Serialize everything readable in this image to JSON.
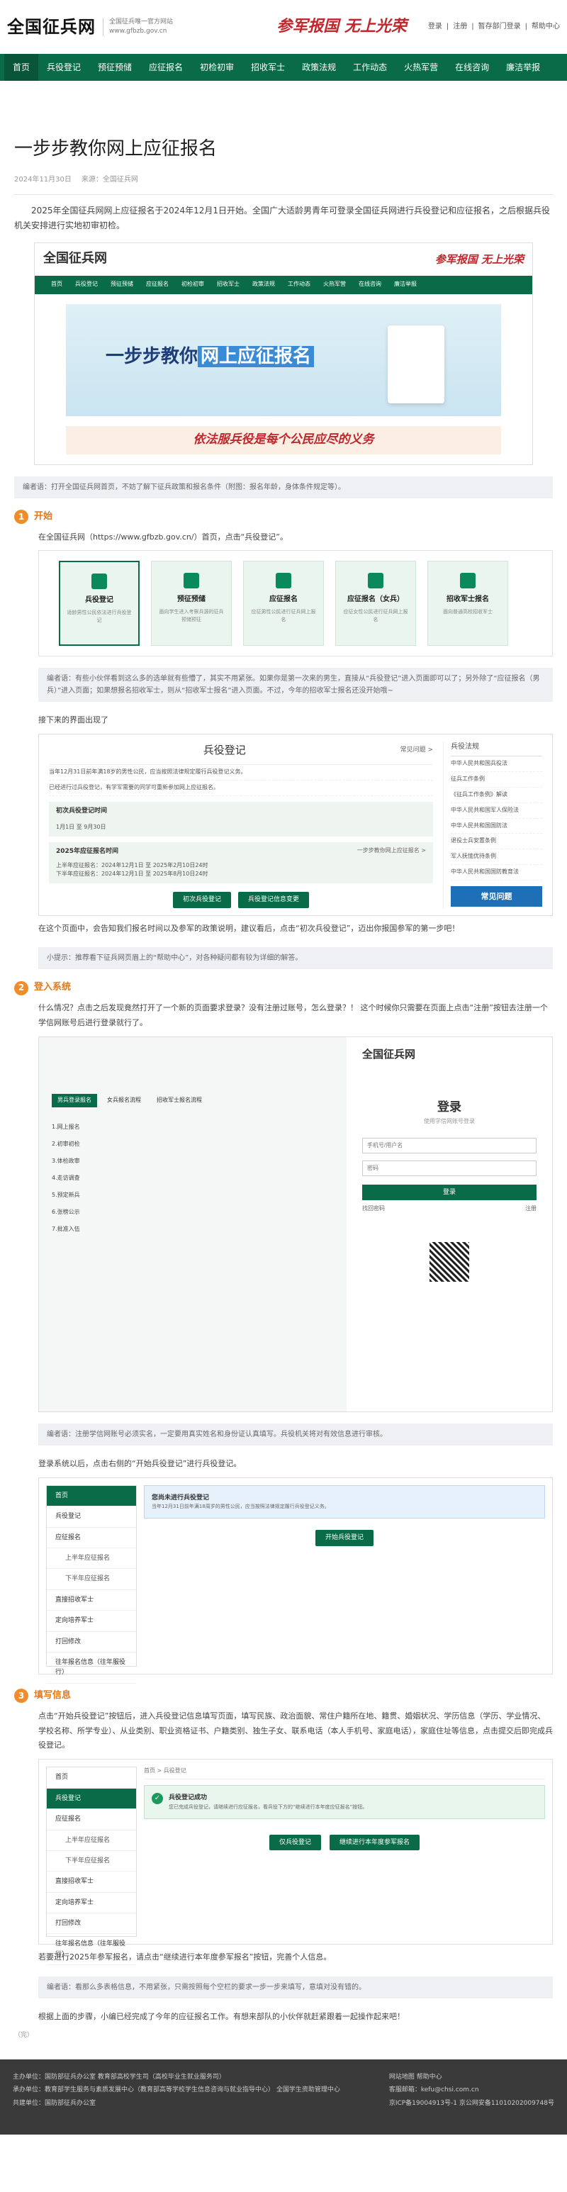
{
  "site": {
    "logo": "全国征兵网",
    "logo_sub1": "全国征兵唯一官方网站",
    "logo_sub2": "www.gfbzb.gov.cn",
    "slogan": "参军报国 无上光荣",
    "toplinks": [
      "登录",
      "注册",
      "暂存部门登录",
      "帮助中心"
    ]
  },
  "nav": [
    "首页",
    "兵役登记",
    "预征预储",
    "应征报名",
    "初检初审",
    "招收军士",
    "政策法规",
    "工作动态",
    "火热军营",
    "在线咨询",
    "廉洁举报"
  ],
  "article": {
    "title": "一步步教你网上应征报名",
    "date": "2024年11月30日",
    "source": "来源：全国征兵网",
    "intro": "2025年全国征兵网网上应征报名于2024年12月1日开始。全国广大适龄男青年可登录全国征兵网进行兵役登记和应征报名，之后根据兵役机关安排进行实地初审初检。",
    "banner_text_a": "一步步教你",
    "banner_text_b": "网上应征报名",
    "banner2_text": "依法服兵役是每个公民应尽的义务",
    "note1": "编者语：打开全国征兵网首页，不妨了解下征兵政策和报名条件（附图：报名年龄，身体条件规定等）。"
  },
  "step1": {
    "num": "1",
    "title": "开始",
    "text": "在全国征兵网（https://www.gfbzb.gov.cn/）首页，点击“兵役登记”。",
    "cards": [
      {
        "title": "兵役登记",
        "desc": "适龄男性公民依法进行兵役登记"
      },
      {
        "title": "预征预储",
        "desc": "面向学生进入考察兵源的征兵预储预征"
      },
      {
        "title": "应征报名",
        "desc": "应征男性公民进行征兵网上报名"
      },
      {
        "title": "应征报名（女兵）",
        "desc": "应征女性公民进行征兵网上报名"
      },
      {
        "title": "招收军士报名",
        "desc": "面向普通高校招收军士"
      }
    ],
    "note": "编者语：有些小伙伴看到这么多的选单就有些懵了，其实不用紧张。如果你是第一次来的男生，直接从“兵役登记”进入页面即可以了；另外除了“应征报名（男兵）”进入页面；如果想报名招收军士，则从“招收军士报名”进入页面。不过，今年的招收军士报名还没开始哦~",
    "text2": "接下来的界面出现了",
    "panel_title": "兵役登记",
    "panel_link": "常见问题 >",
    "panel_lines": [
      "当年12月31日前年满18岁的男性公民，应当按照法律规定履行兵役登记义务。",
      "已经进行过兵役登记，有学军需要的同学可重新参加网上应征报名。"
    ],
    "box1_title": "初次兵役登记时间",
    "box1_value": "1月1日 至 9月30日",
    "box2_title": "2025年应征报名时间",
    "box2_link": "一步步教你网上应征报名 >",
    "box2_lines": [
      "上半年应征报名：2024年12月1日 至 2025年2月10日24时",
      "下半年应征报名：2024年12月1日 至 2025年8月10日24时"
    ],
    "btn1": "初次兵役登记",
    "btn2": "兵役登记信息变更",
    "side_title": "兵役法规",
    "side_items": [
      "中华人民共和国兵役法",
      "征兵工作条例",
      "《征兵工作条例》解读",
      "中华人民共和国军人保险法",
      "中华人民共和国国防法",
      "退役士兵安置条例",
      "军人抚恤优待条例",
      "中华人民共和国国防教育法"
    ],
    "side_btn": "常见问题",
    "text3": "在这个页面中，会告知我们报名时间以及参军的政策说明，建议看后，点击“初次兵役登记”，迈出你报国参军的第一步吧！",
    "note2": "小提示：推荐看下征兵网页眉上的“帮助中心”，对各种疑问都有较为详细的解答。"
  },
  "step2": {
    "num": "2",
    "title": "登入系统",
    "text": "什么情况？点击之后发现竟然打开了一个新的页面要求登录？没有注册过账号，怎么登录？！ 这个时候你只需要在页面上点击“注册”按钮去注册一个学信网账号后进行登录就行了。",
    "login_title": "登录",
    "login_sub": "使用学信网账号登录",
    "ph_phone": "手机号/用户名",
    "ph_pwd": "密码",
    "login_btn": "登录",
    "forgot": "找回密码",
    "register": "注册",
    "tabs": [
      "男兵登录报名",
      "女兵报名流程",
      "招收军士报名流程"
    ],
    "flow": [
      "1.网上报名",
      "2.初审初检",
      "3.体检政审",
      "4.走访调查",
      "5.预定新兵",
      "6.张榜公示",
      "7.批准入伍"
    ],
    "note": "编者语：注册学信网账号必须实名，一定要用真实姓名和身份证认真填写。兵役机关将对有效信息进行审核。",
    "text2": "登录系统以后，点击右侧的“开始兵役登记”进行兵役登记。",
    "menu": [
      "首页",
      "兵役登记",
      "应征报名",
      "上半年应征报名",
      "下半年应征报名",
      "直接招收军士",
      "定向培养军士",
      "打回修改",
      "往年报名信息（往年服役行）"
    ],
    "notice": "您尚未进行兵役登记",
    "notice_sub": "当年12月31日前年满18周岁的男性公民，应当按照法律规定履行兵役登记义务。",
    "start_btn": "开始兵役登记"
  },
  "step3": {
    "num": "3",
    "title": "填写信息",
    "text": "点击“开始兵役登记”按钮后，进入兵役登记信息填写页面，填写民族、政治面貌、常住户籍所在地、籍贯、婚姻状况、学历信息（学历、学业情况、学校名称、所学专业）、从业类别、职业资格证书、户籍类别、独生子女、联系电话（本人手机号、家庭电话），家庭住址等信息，点击提交后即完成兵役登记。",
    "crumb": "首页 > 兵役登记",
    "done": "兵役登记成功",
    "done_sub": "您已完成兵役登记，请继续进行应征报名，看兵役下方的“继续进行本年度应征报名”按钮。",
    "btn1": "仅兵役登记",
    "btn2": "继续进行本年度参军报名",
    "text2": "若要进行2025年参军报名，请点击“继续进行本年度参军报名”按钮，完善个人信息。",
    "note": "编者语：看那么多表格信息，不用紧张，只需按照每个空栏的要求一步一步来填写，意填对没有错的。",
    "text3": "根据上面的步骤，小编已经完成了今年的应征报名工作。有想来部队的小伙伴就赶紧跟着一起操作起来吧！",
    "editor": "（完）"
  },
  "footer": {
    "left": [
      "主办单位：国防部征兵办公室  教育部高校学生司（高校毕业生就业服务司）",
      "承办单位：教育部学生服务与素质发展中心（教育部高等学校学生信息咨询与就业指导中心）  全国学生资助管理中心",
      "共建单位：国防部征兵办公室"
    ],
    "right": [
      "网站地图  帮助中心",
      "客服邮箱：kefu@chsi.com.cn",
      "京ICP备19004913号-1  京公网安备11010202009748号"
    ]
  }
}
